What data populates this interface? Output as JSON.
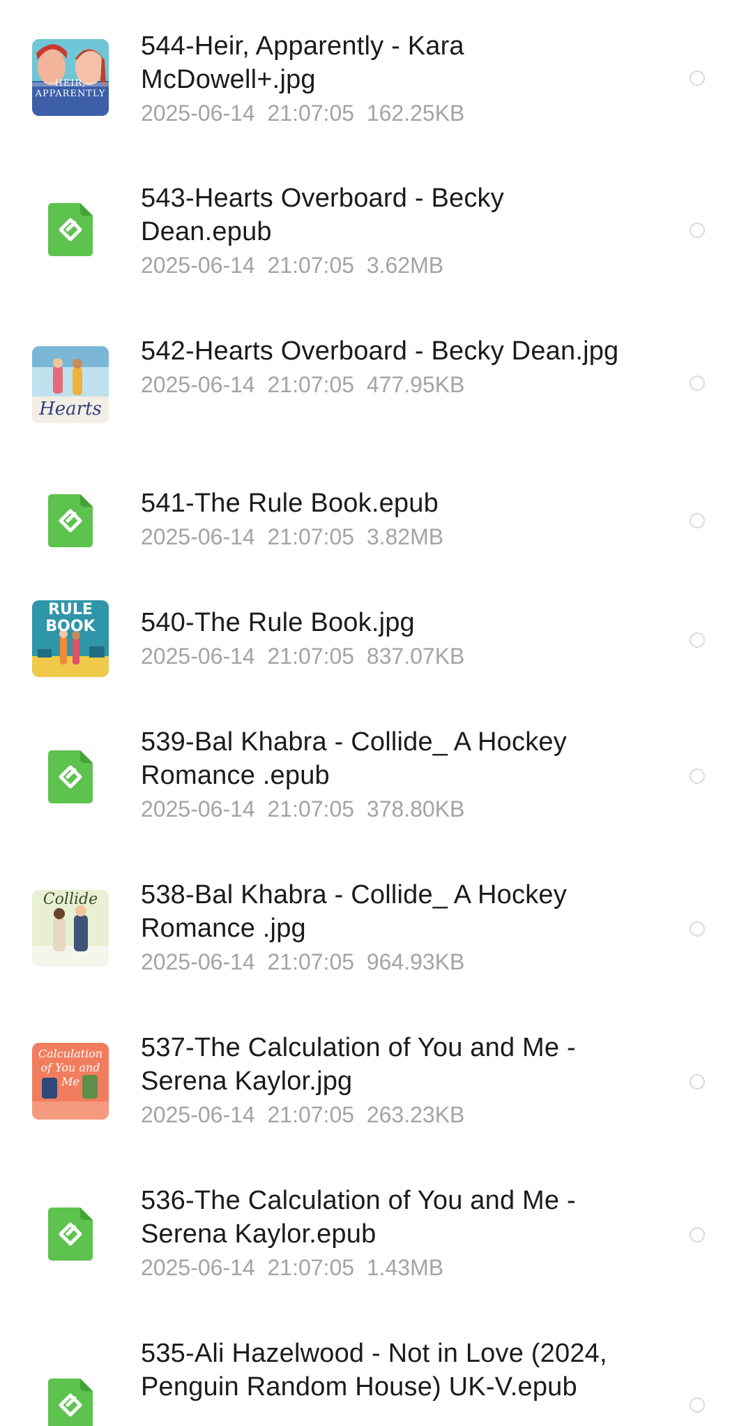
{
  "files": [
    {
      "name": "544-Heir, Apparently - Kara McDowell+.jpg",
      "date": "2025-06-14",
      "time": "21:07:05",
      "size": "162.25KB",
      "icon": "image-thumbnail",
      "cover_text": "HEIR, APPARENTLY"
    },
    {
      "name": "543-Hearts Overboard - Becky Dean.epub",
      "date": "2025-06-14",
      "time": "21:07:05",
      "size": "3.62MB",
      "icon": "epub-icon"
    },
    {
      "name": "542-Hearts Overboard - Becky Dean.jpg",
      "date": "2025-06-14",
      "time": "21:07:05",
      "size": "477.95KB",
      "icon": "image-thumbnail",
      "cover_text": "Hearts"
    },
    {
      "name": "541-The Rule Book.epub",
      "date": "2025-06-14",
      "time": "21:07:05",
      "size": "3.82MB",
      "icon": "epub-icon"
    },
    {
      "name": "540-The Rule Book.jpg",
      "date": "2025-06-14",
      "time": "21:07:05",
      "size": "837.07KB",
      "icon": "image-thumbnail",
      "cover_text": "RULE BOOK"
    },
    {
      "name": "539-Bal Khabra - Collide_ A Hockey Romance .epub",
      "date": "2025-06-14",
      "time": "21:07:05",
      "size": "378.80KB",
      "icon": "epub-icon"
    },
    {
      "name": "538-Bal Khabra - Collide_ A Hockey Romance .jpg",
      "date": "2025-06-14",
      "time": "21:07:05",
      "size": "964.93KB",
      "icon": "image-thumbnail",
      "cover_text": "Collide"
    },
    {
      "name": "537-The Calculation of You and Me - Serena Kaylor.jpg",
      "date": "2025-06-14",
      "time": "21:07:05",
      "size": "263.23KB",
      "icon": "image-thumbnail",
      "cover_text": "Calculation of You and Me"
    },
    {
      "name": "536-The Calculation of You and Me - Serena Kaylor.epub",
      "date": "2025-06-14",
      "time": "21:07:05",
      "size": "1.43MB",
      "icon": "epub-icon"
    },
    {
      "name": "535-Ali Hazelwood - Not in Love (2024, Penguin Random House) UK-V.epub",
      "date": "",
      "time": "",
      "size": "",
      "icon": "epub-icon"
    }
  ],
  "colors": {
    "title_text": "#1b1b1b",
    "meta_text": "#a3a3a8",
    "epub_green": "#5ec24f",
    "radio_border": "#d9d9dc"
  }
}
